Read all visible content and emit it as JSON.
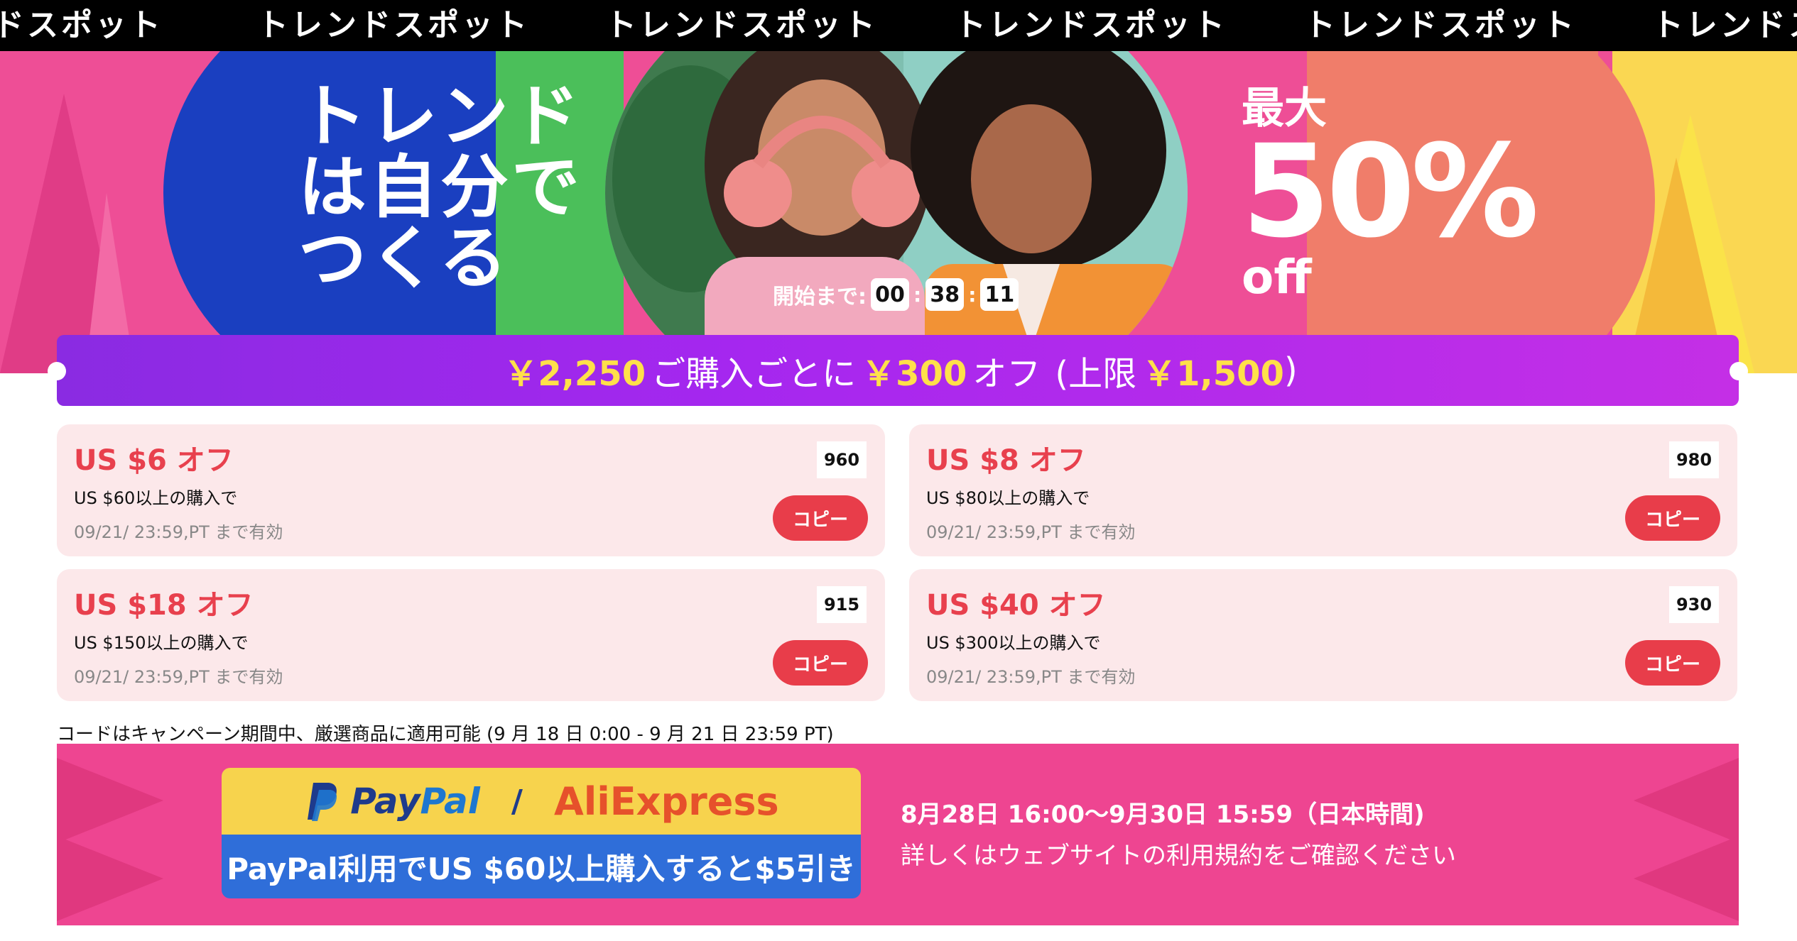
{
  "marquee": {
    "text": "トレンドスポット",
    "visible_fragment_left": "ドスポット",
    "visible_fragment_right": "トレンドス"
  },
  "hero": {
    "title_lines": [
      "トレンド",
      "は自分で",
      "つくる"
    ],
    "sale_line1": "最大",
    "sale_line2": "50%",
    "sale_line3": "off",
    "countdown": {
      "label": "開始まで:",
      "hours": "00",
      "minutes": "38",
      "seconds": "11"
    },
    "colors": {
      "blue": "#1a3fc0",
      "green": "#4bbf5a",
      "pink": "#ee4e96",
      "salmon": "#f07d6a",
      "yellow": "#fbe74a"
    }
  },
  "ribbon": {
    "amount": "￥2,250",
    "text1": "ご購入ごとに",
    "discount": "￥300",
    "text2": "オフ",
    "cap_prefix": "(上限",
    "cap": "￥1,500",
    "cap_suffix": ")"
  },
  "coupons": [
    {
      "title": "US $6 オフ",
      "condition": "US $60以上の購入で",
      "valid": "09/21/ 23:59,PT まで有効",
      "badge": "960",
      "button": "コピー"
    },
    {
      "title": "US $8 オフ",
      "condition": "US $80以上の購入で",
      "valid": "09/21/ 23:59,PT まで有効",
      "badge": "980",
      "button": "コピー"
    },
    {
      "title": "US $18 オフ",
      "condition": "US $150以上の購入で",
      "valid": "09/21/ 23:59,PT まで有効",
      "badge": "915",
      "button": "コピー"
    },
    {
      "title": "US $40 オフ",
      "condition": "US $300以上の購入で",
      "valid": "09/21/ 23:59,PT まで有効",
      "badge": "930",
      "button": "コピー"
    }
  ],
  "note": "コードはキャンペーン期間中、厳選商品に適用可能 (9 月 18 日 0:00 - 9 月 21 日 23:59 PT)",
  "paypal_banner": {
    "logo_pay": "Pay",
    "logo_pal": "Pal",
    "separator": "/",
    "aliexpress": "AliExpress",
    "offer": "PayPal利用でUS $60以上購入すると$5引き",
    "date": "8月28日 16:00〜9月30日 15:59（日本時間)",
    "detail": "詳しくはウェブサイトの利用規約をご確認ください"
  }
}
